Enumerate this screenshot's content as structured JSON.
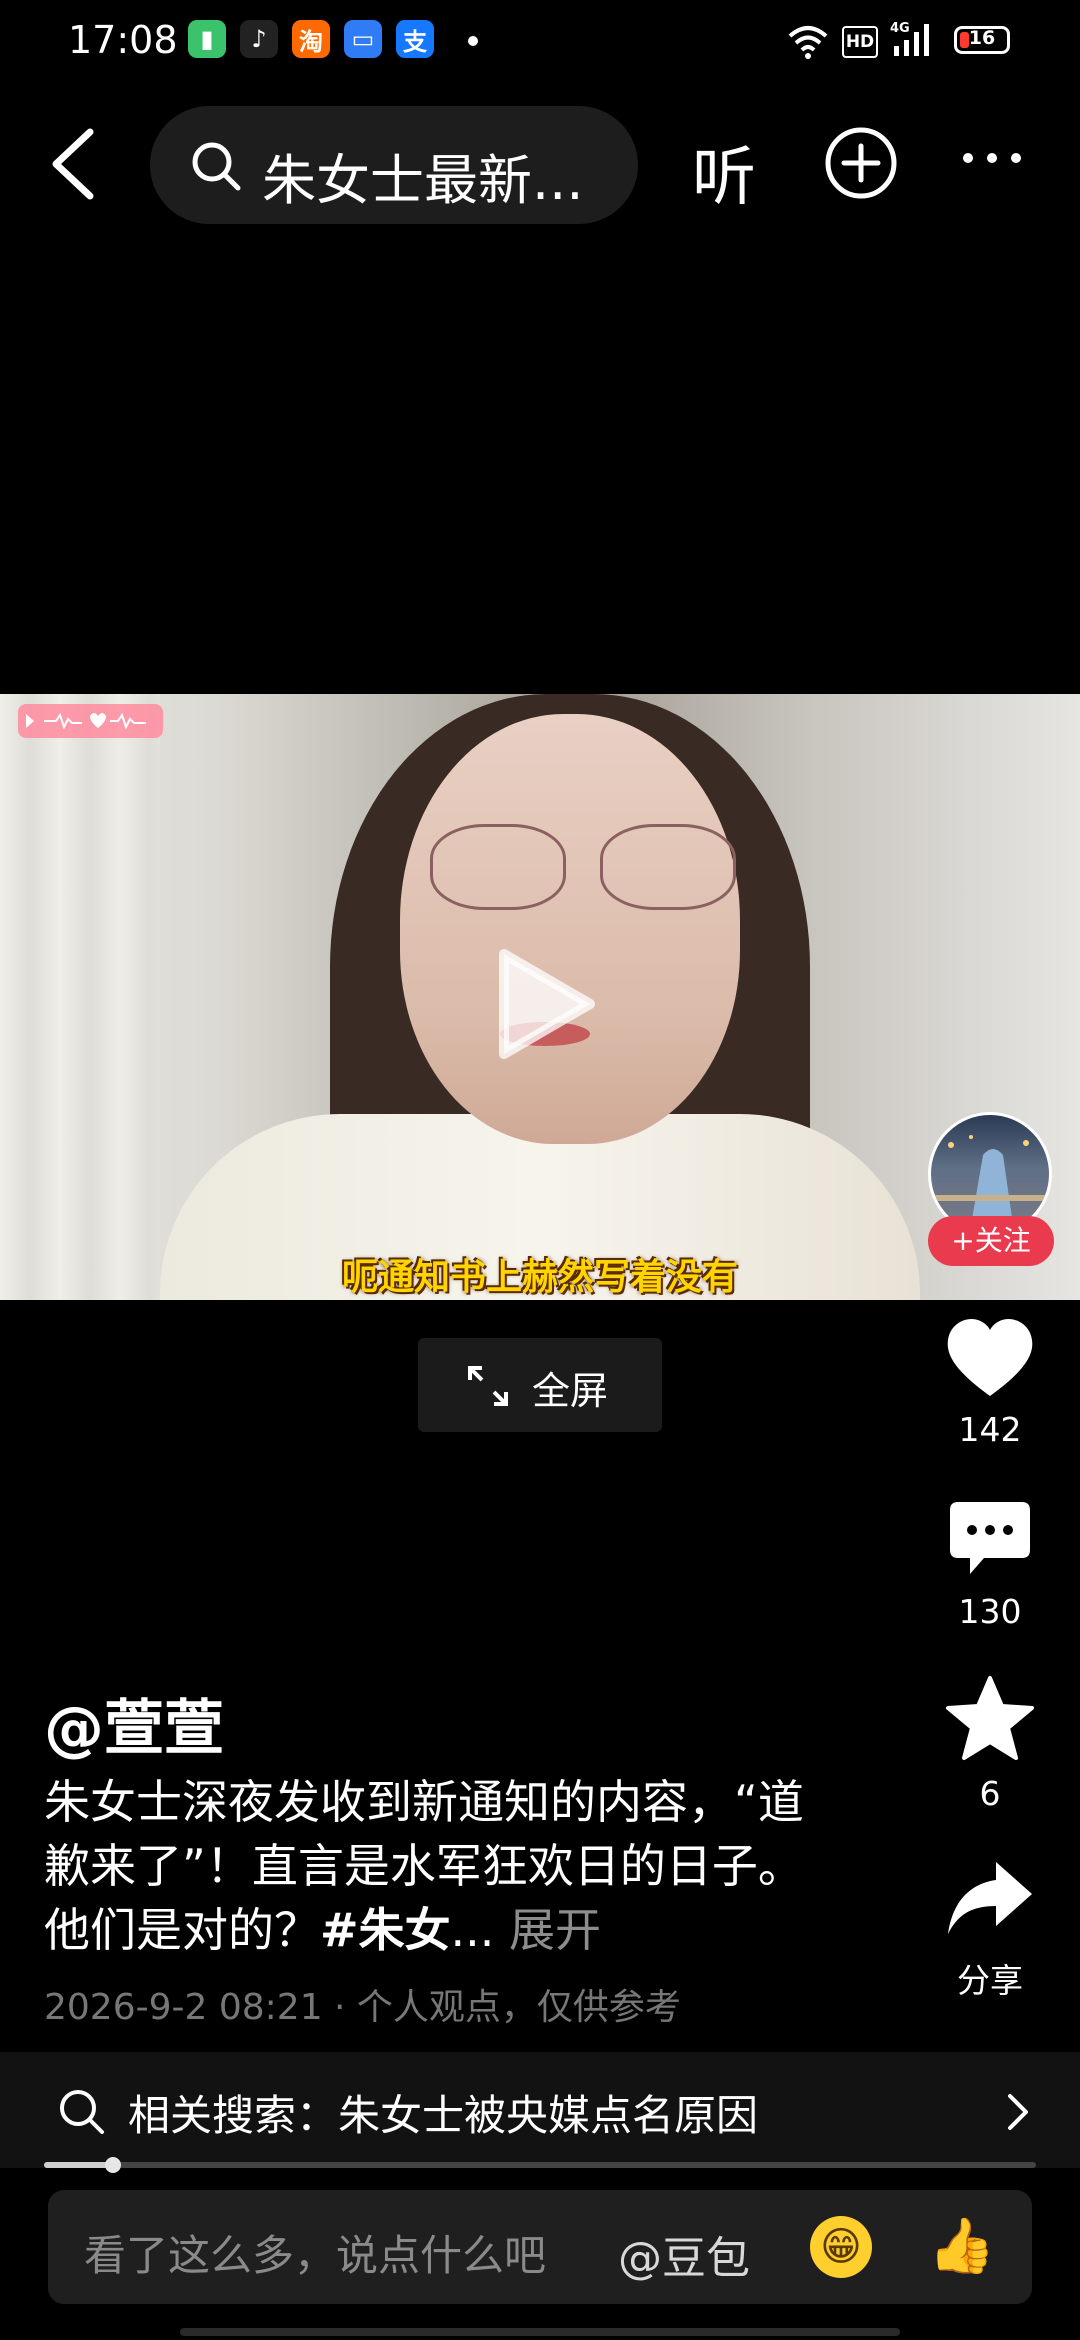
{
  "status_bar": {
    "time": "17:08",
    "apps": [
      {
        "icon": "green-app-icon",
        "glyph": "▮",
        "color": "#3ac36b"
      },
      {
        "icon": "douyin-icon",
        "glyph": "♪",
        "color": "#222222"
      },
      {
        "icon": "taobao-icon",
        "glyph": "淘",
        "color": "#ff6a00"
      },
      {
        "icon": "files-icon",
        "glyph": "▭",
        "color": "#2f7cf6"
      },
      {
        "icon": "alipay-icon",
        "glyph": "支",
        "color": "#1677ff"
      }
    ],
    "hd": "HD",
    "network": "4G",
    "battery": "16"
  },
  "nav": {
    "search_text": "朱女士最新...",
    "listen_label": "听"
  },
  "video": {
    "caption": "呃通知书上赫然写着没有"
  },
  "follow_label": "+关注",
  "fullscreen_label": "全屏",
  "actions": {
    "likes": "142",
    "comments": "130",
    "favorites": "6",
    "share_label": "分享"
  },
  "post": {
    "author": "@萱萱",
    "description": "朱女士深夜发收到新通知的内容，“道歉来了”！直言是水军狂欢日的日子。他们是对的？",
    "hashtag": "#朱女",
    "ellipsis": "...",
    "expand_label": "展开",
    "meta": "2026-9-2 08:21 · 个人观点，仅供参考"
  },
  "related_search": {
    "text": "相关搜索：朱女士被央媒点名原因"
  },
  "progress": {
    "fraction": 0.07
  },
  "comment_bar": {
    "placeholder": "看了这么多，说点什么吧",
    "mention": "@豆包"
  },
  "colors": {
    "accent_red": "#ea3a4e",
    "caption_yellow": "#ffd400"
  }
}
